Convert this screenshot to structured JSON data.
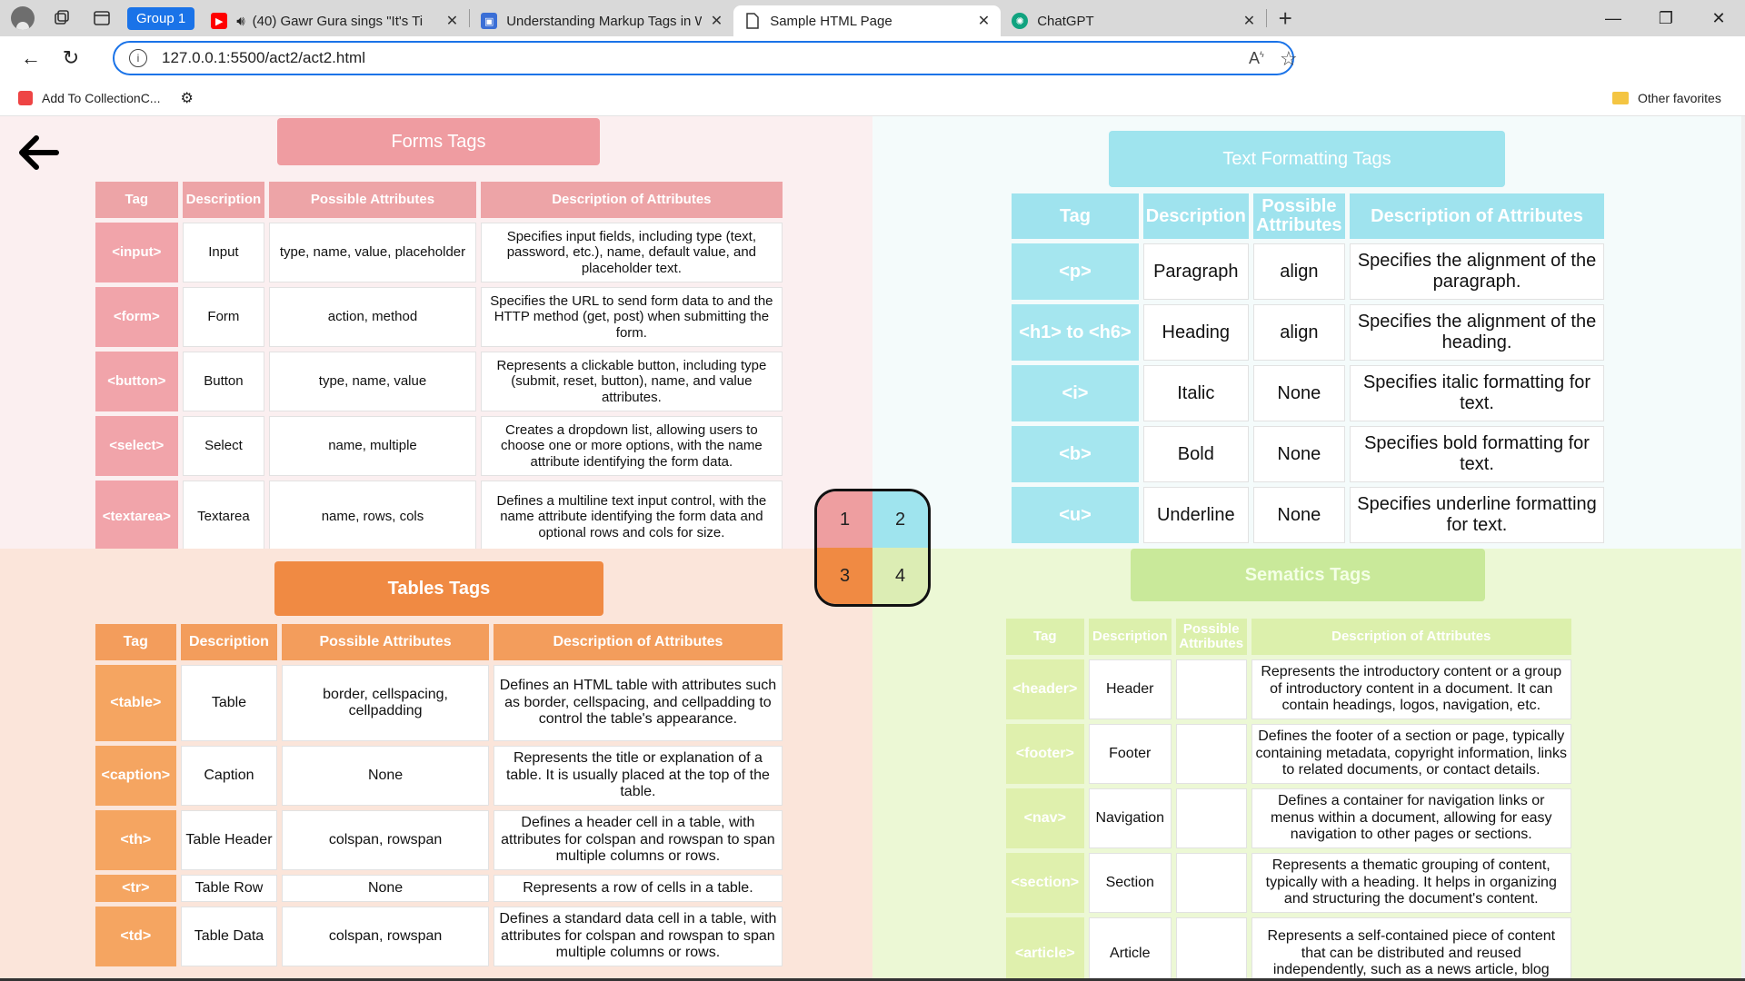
{
  "browser": {
    "group_label": "Group 1",
    "tabs": [
      {
        "title": "(40) Gawr Gura sings \"It's Ti",
        "favicon": "youtube-icon",
        "color": "#ff0000"
      },
      {
        "title": "Understanding Markup Tags in W",
        "favicon": "doc-icon",
        "color": "#3b6fd6"
      },
      {
        "title": "Sample HTML Page",
        "favicon": "page-icon",
        "color": "#ffffff"
      },
      {
        "title": "ChatGPT",
        "favicon": "chatgpt-icon",
        "color": "#10a37f"
      }
    ],
    "url": "127.0.0.1:5500/act2/act2.html",
    "favorites": [
      {
        "label": "Add To CollectionC..."
      }
    ],
    "other_favorites": "Other favorites"
  },
  "nav_quadrants": [
    "1",
    "2",
    "3",
    "4"
  ],
  "forms": {
    "heading": "Forms Tags",
    "headers": [
      "Tag",
      "Description",
      "Possible Attributes",
      "Description of Attributes"
    ],
    "rows": [
      [
        "<input>",
        "Input",
        "type, name, value, placeholder",
        "Specifies input fields, including type (text, password, etc.), name, default value, and placeholder text."
      ],
      [
        "<form>",
        "Form",
        "action, method",
        "Specifies the URL to send form data to and the HTTP method (get, post) when submitting the form."
      ],
      [
        "<button>",
        "Button",
        "type, name, value",
        "Represents a clickable button, including type (submit, reset, button), name, and value attributes."
      ],
      [
        "<select>",
        "Select",
        "name, multiple",
        "Creates a dropdown list, allowing users to choose one or more options, with the name attribute identifying the form data."
      ],
      [
        "<textarea>",
        "Textarea",
        "name, rows, cols",
        "Defines a multiline text input control, with the name attribute identifying the form data and optional rows and cols for size."
      ]
    ]
  },
  "text_formatting": {
    "heading": "Text Formatting Tags",
    "headers": [
      "Tag",
      "Description",
      "Possible Attributes",
      "Description of Attributes"
    ],
    "rows": [
      [
        "<p>",
        "Paragraph",
        "align",
        "Specifies the alignment of the paragraph."
      ],
      [
        "<h1> to <h6>",
        "Heading",
        "align",
        "Specifies the alignment of the heading."
      ],
      [
        "<i>",
        "Italic",
        "None",
        "Specifies italic formatting for text."
      ],
      [
        "<b>",
        "Bold",
        "None",
        "Specifies bold formatting for text."
      ],
      [
        "<u>",
        "Underline",
        "None",
        "Specifies underline formatting for text."
      ]
    ]
  },
  "tables": {
    "heading": "Tables Tags",
    "headers": [
      "Tag",
      "Description",
      "Possible Attributes",
      "Description of Attributes"
    ],
    "rows": [
      [
        "<table>",
        "Table",
        "border, cellspacing, cellpadding",
        "Defines an HTML table with attributes such as border, cellspacing, and cellpadding to control the table's appearance."
      ],
      [
        "<caption>",
        "Caption",
        "None",
        "Represents the title or explanation of a table. It is usually placed at the top of the table."
      ],
      [
        "<th>",
        "Table Header",
        "colspan, rowspan",
        "Defines a header cell in a table, with attributes for colspan and rowspan to span multiple columns or rows."
      ],
      [
        "<tr>",
        "Table Row",
        "None",
        "Represents a row of cells in a table."
      ],
      [
        "<td>",
        "Table Data",
        "colspan, rowspan",
        "Defines a standard data cell in a table, with attributes for colspan and rowspan to span multiple columns or rows."
      ]
    ]
  },
  "semantics": {
    "heading": "Sematics Tags",
    "headers": [
      "Tag",
      "Description",
      "Possible Attributes",
      "Description of Attributes"
    ],
    "rows": [
      [
        "<header>",
        "Header",
        "",
        "Represents the introductory content or a group of introductory content in a document. It can contain headings, logos, navigation, etc."
      ],
      [
        "<footer>",
        "Footer",
        "",
        "Defines the footer of a section or page, typically containing metadata, copyright information, links to related documents, or contact details."
      ],
      [
        "<nav>",
        "Navigation",
        "",
        "Defines a container for navigation links or menus within a document, allowing for easy navigation to other pages or sections."
      ],
      [
        "<section>",
        "Section",
        "",
        "Represents a thematic grouping of content, typically with a heading. It helps in organizing and structuring the document's content."
      ],
      [
        "<article>",
        "Article",
        "",
        "Represents a self-contained piece of content that can be distributed and reused independently, such as a news article, blog"
      ]
    ]
  },
  "colors": {
    "forms_accent": "#eda4a7",
    "text_accent": "#9fe3ee",
    "tables_accent": "#f39d5c",
    "semantics_accent": "#dcf0ac"
  }
}
